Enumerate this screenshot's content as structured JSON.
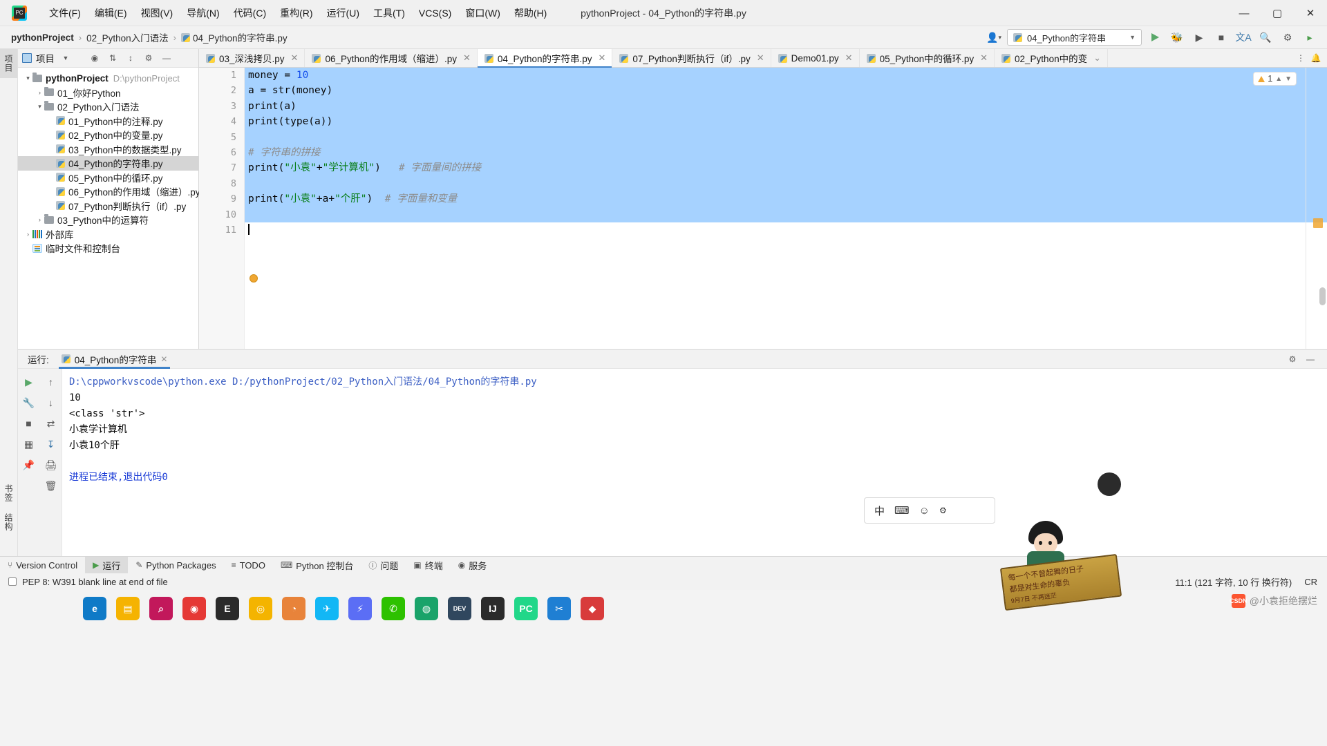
{
  "window": {
    "title": "pythonProject - 04_Python的字符串.py",
    "controls": {
      "minimize": "—",
      "maximize": "▢",
      "close": "✕"
    },
    "app_logo": "pycharm-logo"
  },
  "menu": [
    {
      "label": "文件(F)"
    },
    {
      "label": "编辑(E)"
    },
    {
      "label": "视图(V)"
    },
    {
      "label": "导航(N)"
    },
    {
      "label": "代码(C)"
    },
    {
      "label": "重构(R)"
    },
    {
      "label": "运行(U)"
    },
    {
      "label": "工具(T)"
    },
    {
      "label": "VCS(S)"
    },
    {
      "label": "窗口(W)"
    },
    {
      "label": "帮助(H)"
    }
  ],
  "breadcrumbs": [
    {
      "label": "pythonProject",
      "bold": true
    },
    {
      "label": "02_Python入门语法",
      "bold": false
    },
    {
      "label": "04_Python的字符串.py",
      "bold": false,
      "icon": "python-file-icon"
    }
  ],
  "navbar_right": {
    "account_icon": "user-avatar-icon",
    "run_config": "04_Python的字符串",
    "run_icon": "run-icon",
    "debug_icon": "debug-icon",
    "run_coverage_icon": "run-with-coverage-icon",
    "stop_icon": "stop-icon",
    "translate_icon": "translate-icon",
    "search_icon": "search-icon",
    "settings_icon": "settings-icon",
    "more_icon": "more-icon"
  },
  "left_strip": {
    "top_tabs": [
      {
        "label": "项目",
        "selected": true
      }
    ],
    "bottom_tabs": [
      {
        "label": "书签"
      },
      {
        "label": "结构"
      }
    ]
  },
  "project_panel": {
    "title": "项目",
    "header_icons": [
      "scope-icon",
      "collapse-all-icon",
      "expand-all-icon",
      "settings-icon",
      "hide-icon"
    ],
    "tree": [
      {
        "indent": 0,
        "arrow": "▾",
        "icon": "folder-icon",
        "label": "pythonProject",
        "bold": true,
        "path": "D:\\pythonProject",
        "selected": false
      },
      {
        "indent": 1,
        "arrow": "›",
        "icon": "folder-icon",
        "label": "01_你好Python",
        "bold": false,
        "path": "",
        "selected": false
      },
      {
        "indent": 1,
        "arrow": "▾",
        "icon": "folder-icon",
        "label": "02_Python入门语法",
        "bold": false,
        "path": "",
        "selected": false
      },
      {
        "indent": 2,
        "arrow": "",
        "icon": "python-file-icon",
        "label": "01_Python中的注释.py",
        "bold": false,
        "path": "",
        "selected": false
      },
      {
        "indent": 2,
        "arrow": "",
        "icon": "python-file-icon",
        "label": "02_Python中的变量.py",
        "bold": false,
        "path": "",
        "selected": false
      },
      {
        "indent": 2,
        "arrow": "",
        "icon": "python-file-icon",
        "label": "03_Python中的数据类型.py",
        "bold": false,
        "path": "",
        "selected": false
      },
      {
        "indent": 2,
        "arrow": "",
        "icon": "python-file-icon",
        "label": "04_Python的字符串.py",
        "bold": false,
        "path": "",
        "selected": true
      },
      {
        "indent": 2,
        "arrow": "",
        "icon": "python-file-icon",
        "label": "05_Python中的循环.py",
        "bold": false,
        "path": "",
        "selected": false
      },
      {
        "indent": 2,
        "arrow": "",
        "icon": "python-file-icon",
        "label": "06_Python的作用域（缩进）.py",
        "bold": false,
        "path": "",
        "selected": false
      },
      {
        "indent": 2,
        "arrow": "",
        "icon": "python-file-icon",
        "label": "07_Python判断执行（if）.py",
        "bold": false,
        "path": "",
        "selected": false
      },
      {
        "indent": 1,
        "arrow": "›",
        "icon": "folder-icon",
        "label": "03_Python中的运算符",
        "bold": false,
        "path": "",
        "selected": false
      },
      {
        "indent": 0,
        "arrow": "›",
        "icon": "library-icon",
        "label": "外部库",
        "bold": false,
        "path": "",
        "selected": false
      },
      {
        "indent": 0,
        "arrow": "",
        "icon": "scratch-icon",
        "label": "临时文件和控制台",
        "bold": false,
        "path": "",
        "selected": false
      }
    ]
  },
  "editor_tabs": [
    {
      "label": "03_深浅拷贝.py",
      "active": false
    },
    {
      "label": "06_Python的作用域（缩进）.py",
      "active": false
    },
    {
      "label": "04_Python的字符串.py",
      "active": true
    },
    {
      "label": "07_Python判断执行（if）.py",
      "active": false
    },
    {
      "label": "Demo01.py",
      "active": false
    },
    {
      "label": "05_Python中的循环.py",
      "active": false
    },
    {
      "label": "02_Python中的变",
      "active": false
    }
  ],
  "editor_tabs_right": {
    "chevron": "chevron-down-icon",
    "more": "more-vertical-icon",
    "notifications": "bell-icon"
  },
  "editor": {
    "line_numbers": [
      "1",
      "2",
      "3",
      "4",
      "5",
      "6",
      "7",
      "8",
      "9",
      "10",
      "11"
    ],
    "lines": [
      {
        "n": 1,
        "highlight": true,
        "tokens": [
          {
            "t": "money = ",
            "c": "plain"
          },
          {
            "t": "10",
            "c": "num"
          }
        ]
      },
      {
        "n": 2,
        "highlight": true,
        "tokens": [
          {
            "t": "a = str(money)",
            "c": "plain"
          }
        ]
      },
      {
        "n": 3,
        "highlight": true,
        "tokens": [
          {
            "t": "print(a)",
            "c": "plain"
          }
        ]
      },
      {
        "n": 4,
        "highlight": true,
        "tokens": [
          {
            "t": "print(type(a))",
            "c": "plain"
          }
        ]
      },
      {
        "n": 5,
        "highlight": true,
        "tokens": [
          {
            "t": "",
            "c": "plain"
          }
        ]
      },
      {
        "n": 6,
        "highlight": true,
        "tokens": [
          {
            "t": "# 字符串的拼接",
            "c": "com"
          }
        ]
      },
      {
        "n": 7,
        "highlight": true,
        "tokens": [
          {
            "t": "print(",
            "c": "plain"
          },
          {
            "t": "\"小袁\"",
            "c": "str"
          },
          {
            "t": "+",
            "c": "plain"
          },
          {
            "t": "\"学计算机\"",
            "c": "str"
          },
          {
            "t": ")   ",
            "c": "plain"
          },
          {
            "t": "# 字面量间的拼接",
            "c": "com"
          }
        ]
      },
      {
        "n": 8,
        "highlight": true,
        "tokens": [
          {
            "t": "",
            "c": "plain"
          }
        ]
      },
      {
        "n": 9,
        "highlight": true,
        "tokens": [
          {
            "t": "print(",
            "c": "plain"
          },
          {
            "t": "\"小袁\"",
            "c": "str"
          },
          {
            "t": "+a+",
            "c": "plain"
          },
          {
            "t": "\"个肝\"",
            "c": "str"
          },
          {
            "t": ")  ",
            "c": "plain"
          },
          {
            "t": "# 字面量和变量",
            "c": "com"
          }
        ]
      },
      {
        "n": 10,
        "highlight": true,
        "tokens": [
          {
            "t": "",
            "c": "plain"
          }
        ]
      },
      {
        "n": 11,
        "highlight": false,
        "tokens": [
          {
            "t": "",
            "c": "caret"
          }
        ]
      }
    ],
    "warning_count": "1",
    "warning_icon": "warning-triangle-icon",
    "intention_bulb": "intention-bulb-icon"
  },
  "run_panel": {
    "header_label": "运行:",
    "tab_label": "04_Python的字符串",
    "tab_icon": "python-icon",
    "close_icon": "close-icon",
    "settings_icon": "settings-icon",
    "hide_icon": "hide-icon",
    "sidebar_icons": [
      "rerun-icon",
      "wrench-icon",
      "stop-icon",
      "up-arrow-icon",
      "down-arrow-icon",
      "wrap-icon",
      "scroll-to-end-icon",
      "layout-icon",
      "print-icon",
      "pin-icon",
      "trash-icon"
    ],
    "console_lines": [
      {
        "text": "D:\\cppworkvscode\\python.exe D:/pythonProject/02_Python入门语法/04_Python的字符串.py",
        "style": "link"
      },
      {
        "text": "10",
        "style": "plain"
      },
      {
        "text": "<class 'str'>",
        "style": "plain"
      },
      {
        "text": "小袁学计算机",
        "style": "plain"
      },
      {
        "text": "小袁10个肝",
        "style": "plain"
      },
      {
        "text": "",
        "style": "plain"
      },
      {
        "text": "进程已结束,退出代码0",
        "style": "blue"
      }
    ]
  },
  "bottom_toolbar": [
    {
      "label": "Version Control",
      "icon": "branch-icon",
      "selected": false
    },
    {
      "label": "运行",
      "icon": "run-icon",
      "selected": true
    },
    {
      "label": "Python Packages",
      "icon": "package-icon",
      "selected": false
    },
    {
      "label": "TODO",
      "icon": "todo-icon",
      "selected": false
    },
    {
      "label": "Python 控制台",
      "icon": "console-icon",
      "selected": false
    },
    {
      "label": "问题",
      "icon": "problems-icon",
      "selected": false
    },
    {
      "label": "终端",
      "icon": "terminal-icon",
      "selected": false
    },
    {
      "label": "服务",
      "icon": "services-icon",
      "selected": false
    }
  ],
  "status_bar": {
    "checkbox": "inspection-checkbox",
    "message": "PEP 8: W391 blank line at end of file",
    "caret_position": "11:1 (121 字符, 10 行 换行符)",
    "line_separator": "CR"
  },
  "taskbar": {
    "icons": [
      {
        "name": "edge-icon",
        "glyph": "e",
        "color": "#0f7ac7"
      },
      {
        "name": "file-explorer-icon",
        "glyph": "▤",
        "color": "#f5b301"
      },
      {
        "name": "search-icon",
        "glyph": "⌕",
        "color": "#c2185b"
      },
      {
        "name": "media-icon",
        "glyph": "◉",
        "color": "#e53935"
      },
      {
        "name": "epic-games-icon",
        "glyph": "E",
        "color": "#2a2a2a"
      },
      {
        "name": "chrome-icon",
        "glyph": "◎",
        "color": "#f4b400"
      },
      {
        "name": "recorder-icon",
        "glyph": "◔",
        "color": "#e8833a"
      },
      {
        "name": "tim-icon",
        "glyph": "✈",
        "color": "#12b7f5"
      },
      {
        "name": "flash-icon",
        "glyph": "⚡",
        "color": "#5b6ef5"
      },
      {
        "name": "wechat-icon",
        "glyph": "✆",
        "color": "#2dc100"
      },
      {
        "name": "browser-icon",
        "glyph": "◍",
        "color": "#1aa36a"
      },
      {
        "name": "dev-icon",
        "glyph": "DEV",
        "color": "#30475e"
      },
      {
        "name": "idea-icon",
        "glyph": "IJ",
        "color": "#2b2b2b"
      },
      {
        "name": "pycharm-icon",
        "glyph": "PC",
        "color": "#21d789"
      },
      {
        "name": "vscode-icon",
        "glyph": "✂",
        "color": "#1f7fd3"
      },
      {
        "name": "app-icon",
        "glyph": "◆",
        "color": "#d83b3b"
      }
    ],
    "ime": {
      "mode": "中",
      "keyboard_icon": "keyboard-icon",
      "emoji_icon": "emoji-icon",
      "settings_icon": "settings-icon"
    },
    "banner_text": "每一个不曾起舞的日子\n都是对生命的辜负",
    "banner_date": "9月7日 不再迷茫",
    "watermark": "@小袁拒绝摆烂",
    "watermark_brand": "CSDN"
  }
}
